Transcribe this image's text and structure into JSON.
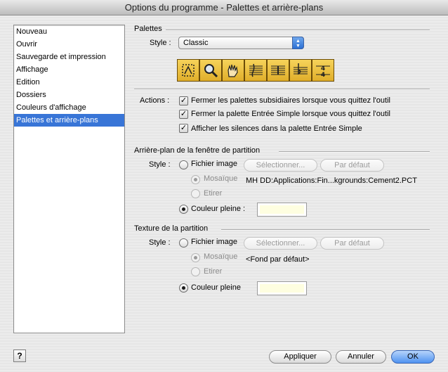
{
  "window": {
    "title": "Options du programme - Palettes et arrière-plans"
  },
  "sidebar": {
    "items": [
      {
        "label": "Nouveau",
        "selected": false
      },
      {
        "label": "Ouvrir",
        "selected": false
      },
      {
        "label": "Sauvegarde et impression",
        "selected": false
      },
      {
        "label": "Affichage",
        "selected": false
      },
      {
        "label": "Edition",
        "selected": false
      },
      {
        "label": "Dossiers",
        "selected": false
      },
      {
        "label": "Couleurs d'affichage",
        "selected": false
      },
      {
        "label": "Palettes et arrière-plans",
        "selected": true
      }
    ]
  },
  "palettes": {
    "section_title": "Palettes",
    "style_label": "Style :",
    "style_value": "Classic",
    "tools": [
      "hand-grabber-tool-icon",
      "zoom-tool-icon",
      "selection-hand-tool-icon",
      "staff-tool-icon",
      "measure-tool-icon",
      "key-signature-tool-icon",
      "time-signature-tool-icon"
    ]
  },
  "actions": {
    "label": "Actions :",
    "options": [
      {
        "label": "Fermer les palettes subsidiaires lorsque vous quittez l'outil",
        "checked": true
      },
      {
        "label": "Fermer la palette Entrée Simple lorsque vous quittez l'outil",
        "checked": true
      },
      {
        "label": "Afficher les silences dans la palette Entrée Simple",
        "checked": true
      }
    ]
  },
  "background": {
    "section_title": "Arrière-plan de la fenêtre de partition",
    "style_label": "Style :",
    "image_file_label": "Fichier image",
    "select_button": "Sélectionner...",
    "default_button": "Par défaut",
    "tile_label": "Mosaïque",
    "stretch_label": "Etirer",
    "image_path": "MH DD:Applications:Fin...kgrounds:Cement2.PCT",
    "solid_color_label": "Couleur pleine :",
    "selected_style": "solid",
    "color": "#fefee0"
  },
  "texture": {
    "section_title": "Texture de la partition",
    "style_label": "Style :",
    "image_file_label": "Fichier image",
    "select_button": "Sélectionner...",
    "default_button": "Par défaut",
    "tile_label": "Mosaïque",
    "stretch_label": "Etirer",
    "image_path": "<Fond par défaut>",
    "solid_color_label": "Couleur pleine",
    "selected_style": "solid",
    "color": "#fefee0"
  },
  "footer": {
    "help_label": "?",
    "apply_label": "Appliquer",
    "cancel_label": "Annuler",
    "ok_label": "OK"
  },
  "colors": {
    "accent": "#3875d7",
    "palette_gold": "#e0ae2a"
  }
}
